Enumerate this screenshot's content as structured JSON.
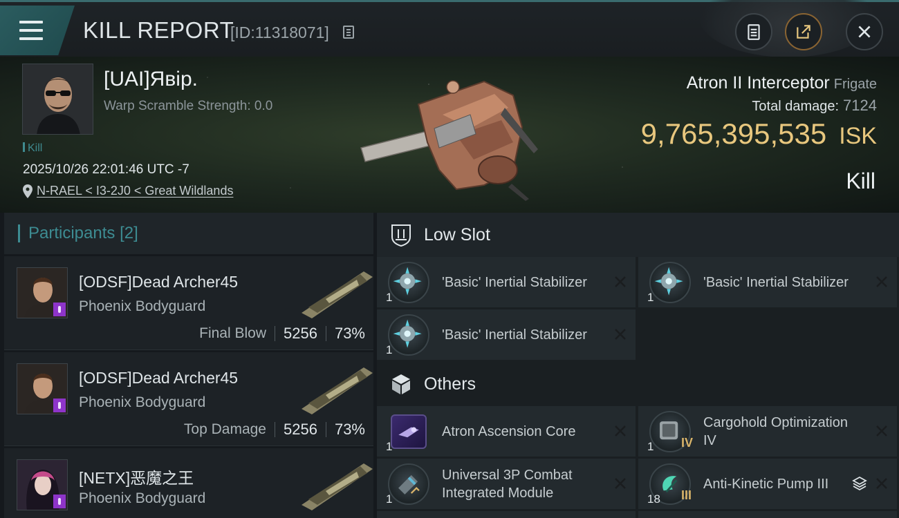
{
  "header": {
    "title": "KILL REPORT",
    "report_id": "[ID:11318071]"
  },
  "victim": {
    "name": "[UAI]Явip.",
    "scramble": "Warp Scramble Strength: 0.0",
    "tag": "Kill",
    "datetime": "2025/10/26 22:01:46 UTC -7",
    "location": "N-RAEL < I3-2J0 < Great Wildlands",
    "ship_name": "Atron II Interceptor",
    "ship_class": "Frigate",
    "total_damage_label": "Total damage:",
    "total_damage": "7124",
    "isk_value": "9,765,395,535",
    "isk_unit": "ISK",
    "result": "Kill"
  },
  "participants": {
    "title": "Participants",
    "count": "[2]",
    "items": [
      {
        "name": "[ODSF]Dead Archer45",
        "ship": "Phoenix Bodyguard",
        "role": "Final Blow",
        "damage": "5256",
        "percent": "73%"
      },
      {
        "name": "[ODSF]Dead Archer45",
        "ship": "Phoenix Bodyguard",
        "role": "Top Damage",
        "damage": "5256",
        "percent": "73%"
      },
      {
        "name": "[NETX]恶魔之王",
        "ship": "Phoenix Bodyguard"
      }
    ]
  },
  "modules": {
    "low_slot": {
      "title": "Low Slot",
      "items": [
        {
          "name": "'Basic' Inertial Stabilizer",
          "qty": "1"
        },
        {
          "name": "'Basic' Inertial Stabilizer",
          "qty": "1"
        },
        {
          "name": "'Basic' Inertial Stabilizer",
          "qty": "1"
        }
      ]
    },
    "others": {
      "title": "Others",
      "items": [
        {
          "name": "Atron Ascension Core",
          "qty": "1"
        },
        {
          "name": "Cargohold Optimization IV",
          "qty": "1",
          "tier": "IV"
        },
        {
          "name": "Universal 3P Combat Integrated Module",
          "qty": "1"
        },
        {
          "name": "Anti-Kinetic Pump III",
          "qty": "18",
          "tier": "III"
        }
      ]
    }
  },
  "colors": {
    "accent": "#3d8c92",
    "isk": "#e8c77e",
    "badge": "#8e34c9"
  }
}
